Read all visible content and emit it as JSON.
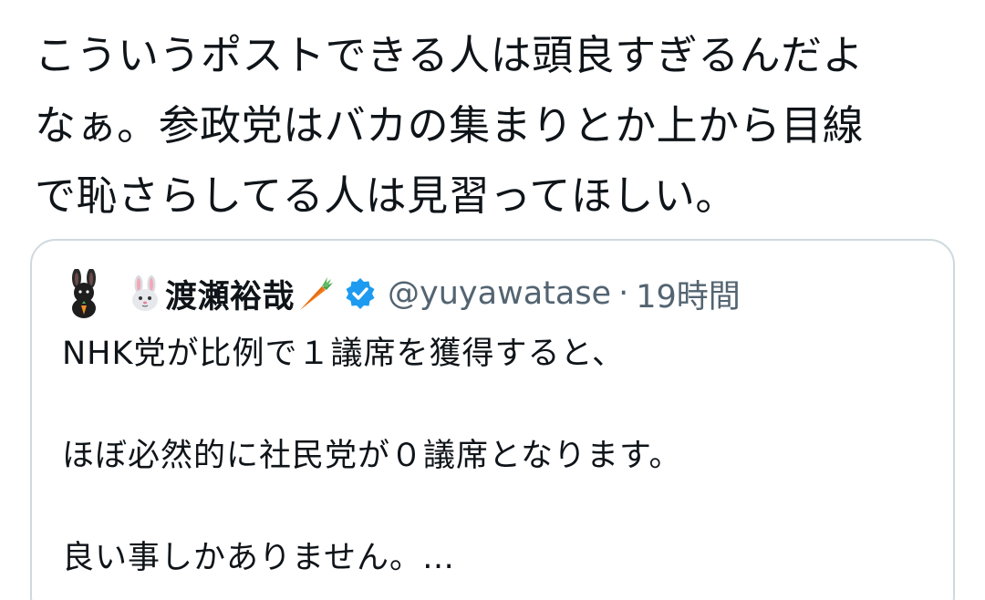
{
  "post": {
    "lines": [
      "こういうポストできる人は頭良すぎるんだよ",
      "なぁ。参政党はバカの集まりとか上から目線",
      "で恥さらしてる人は見習ってほしい。"
    ]
  },
  "quoted_post": {
    "author_name": "渡瀬裕哉",
    "author_handle": "@yuyawatase",
    "separator": "·",
    "time": "19時間",
    "avatar_icon": "rabbit-silhouette-avatar",
    "name_icons": [
      "rabbit-face-icon",
      "carrot-icon",
      "verified-badge-icon"
    ],
    "paragraphs": [
      "NHK党が比例で１議席を獲得すると、",
      "ほぼ必然的に社民党が０議席となります。",
      "良い事しかありません。…"
    ],
    "colors": {
      "verified": "#1d9bf0",
      "secondary_text": "#536471",
      "border": "#cfd9de"
    }
  }
}
